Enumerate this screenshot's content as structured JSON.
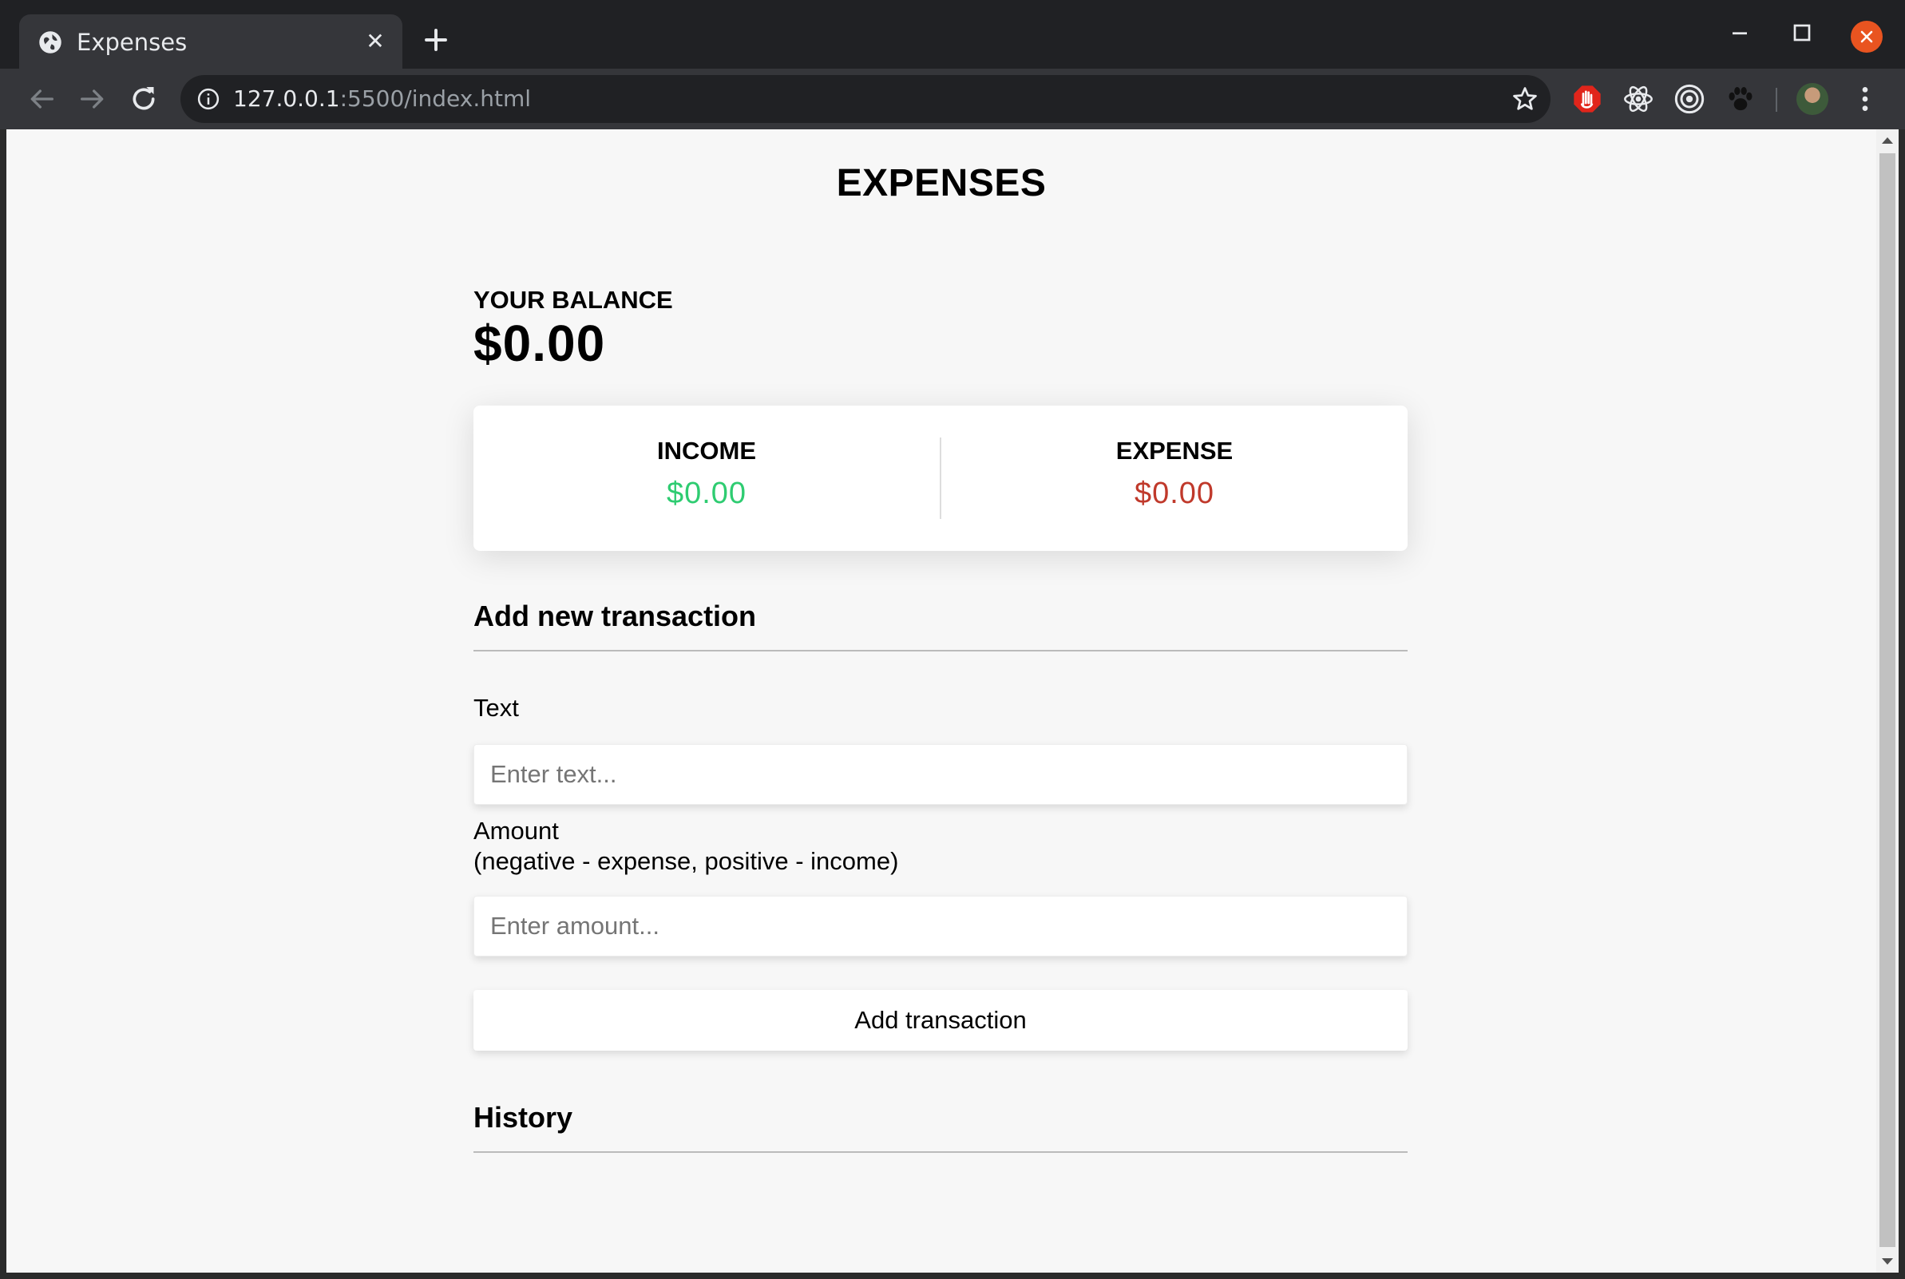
{
  "browser": {
    "tab_title": "Expenses",
    "tab_close": "✕",
    "url_host": "127.0.0.1",
    "url_rest": ":5500/index.html"
  },
  "app": {
    "title": "EXPENSES",
    "balance_label": "YOUR BALANCE",
    "balance_value": "$0.00",
    "income_label": "INCOME",
    "income_value": "$0.00",
    "expense_label": "EXPENSE",
    "expense_value": "$0.00",
    "add_section_title": "Add new transaction",
    "text_label": "Text",
    "text_placeholder": "Enter text...",
    "amount_label_line1": "Amount",
    "amount_label_line2": "(negative - expense, positive - income)",
    "amount_placeholder": "Enter amount...",
    "add_button": "Add transaction",
    "history_title": "History"
  },
  "colors": {
    "income": "#2ecc71",
    "expense": "#c0392b",
    "close_button": "#e95420"
  },
  "icons": {
    "tab_favicon": "globe-icon",
    "new_tab": "plus-icon",
    "back": "arrow-left-icon",
    "forward": "arrow-right-icon",
    "reload": "reload-icon",
    "info": "info-icon",
    "bookmark": "star-icon",
    "extensions": [
      "adblock-hand-icon",
      "react-devtools-icon",
      "target-icon",
      "paw-icon"
    ],
    "menu": "kebab-menu-icon"
  }
}
